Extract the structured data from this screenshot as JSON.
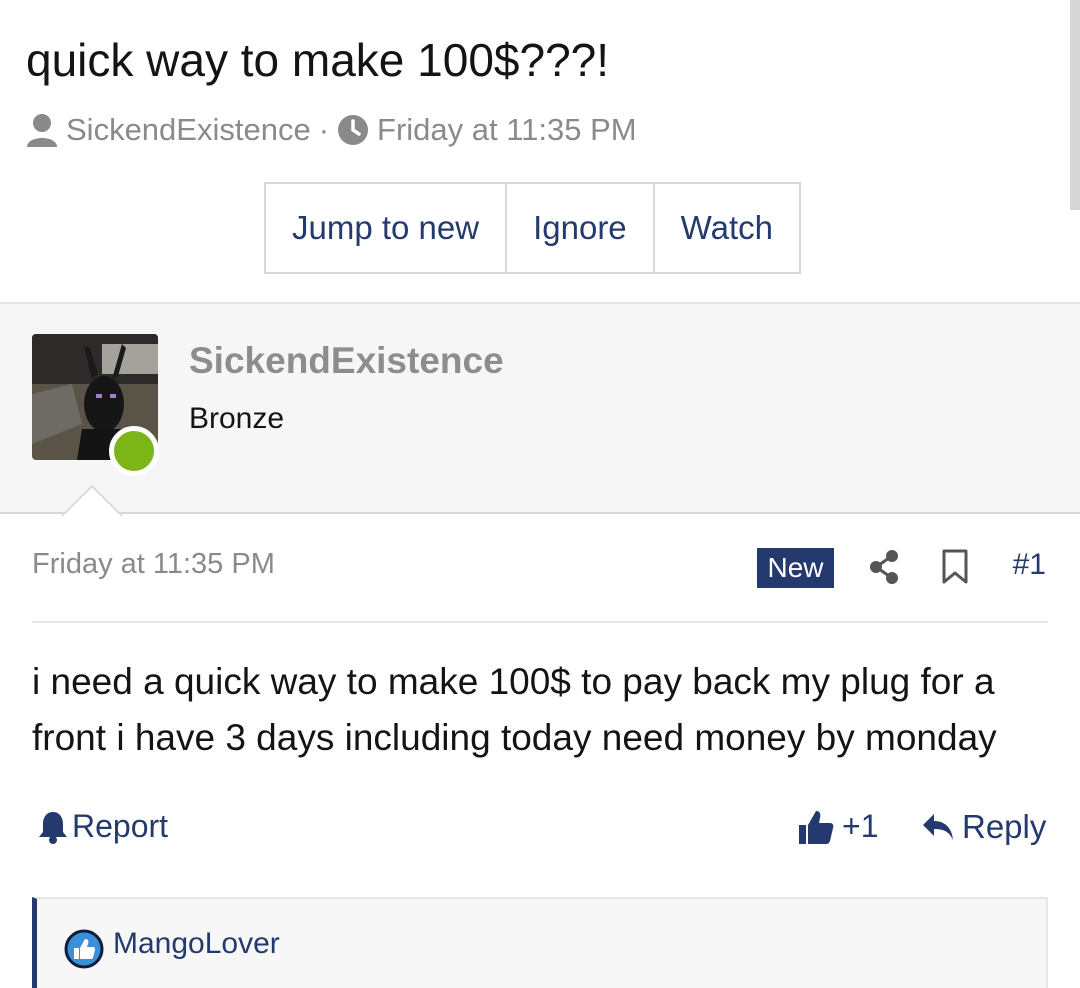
{
  "thread": {
    "title": "quick way to make 100$???!",
    "author": "SickendExistence",
    "separator": "·",
    "time": "Friday at 11:35 PM"
  },
  "actions": {
    "jump_to_new": "Jump to new",
    "ignore": "Ignore",
    "watch": "Watch"
  },
  "post": {
    "username": "SickendExistence",
    "rank": "Bronze",
    "date": "Friday at 11:35 PM",
    "badge": "New",
    "number": "#1",
    "body": "i need a quick way to make 100$ to pay back my plug for a front i have 3 days including today need money by monday",
    "report_label": "Report",
    "like_count": "+1",
    "reply_label": "Reply"
  },
  "reactions": {
    "user": "MangoLover"
  },
  "colors": {
    "accent": "#243a6e",
    "online": "#7cb518",
    "muted": "#8a8a8a"
  },
  "icons": [
    "user-icon",
    "clock-icon",
    "share-icon",
    "bookmark-icon",
    "bell-icon",
    "thumbs-up-icon",
    "reply-icon",
    "like-reaction-icon"
  ]
}
